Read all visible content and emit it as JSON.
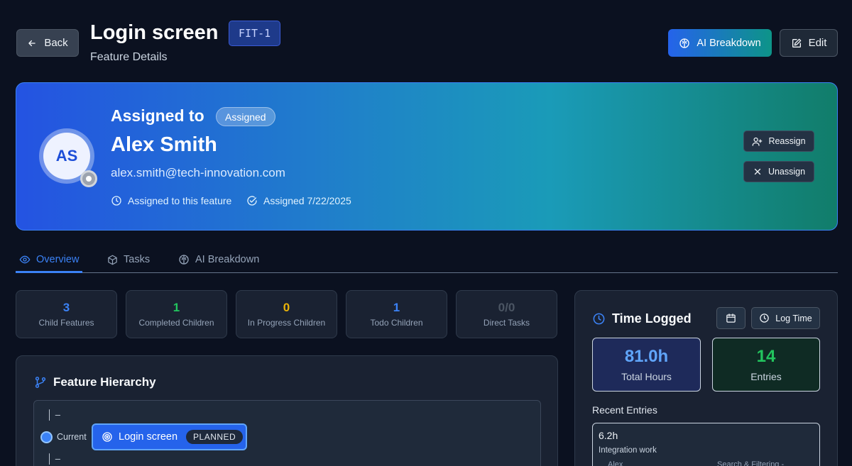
{
  "header": {
    "back_label": "Back",
    "title": "Login screen",
    "id_badge": "FIT-1",
    "subtitle": "Feature Details",
    "ai_breakdown_label": "AI Breakdown",
    "edit_label": "Edit"
  },
  "assignment": {
    "heading": "Assigned to",
    "status": "Assigned",
    "initials": "AS",
    "name": "Alex Smith",
    "email": "alex.smith@tech-innovation.com",
    "meta_scope": "Assigned to this feature",
    "meta_date": "Assigned 7/22/2025",
    "reassign_label": "Reassign",
    "unassign_label": "Unassign"
  },
  "tabs": [
    {
      "label": "Overview",
      "active": true
    },
    {
      "label": "Tasks",
      "active": false
    },
    {
      "label": "AI Breakdown",
      "active": false
    }
  ],
  "stats": [
    {
      "value": "3",
      "label": "Child Features",
      "color": "#3b82f6"
    },
    {
      "value": "1",
      "label": "Completed Children",
      "color": "#22c55e"
    },
    {
      "value": "0",
      "label": "In Progress Children",
      "color": "#eab308"
    },
    {
      "value": "1",
      "label": "Todo Children",
      "color": "#3b82f6"
    },
    {
      "value": "0/0",
      "label": "Direct Tasks",
      "color": "#4b5563"
    }
  ],
  "hierarchy": {
    "title": "Feature Hierarchy",
    "line_above": "│ –",
    "current_label": "Current",
    "feature_name": "Login screen",
    "feature_status": "PLANNED",
    "line_below": "│ –"
  },
  "time": {
    "title": "Time Logged",
    "log_time_label": "Log Time",
    "total_hours": "81.0h",
    "total_hours_label": "Total Hours",
    "entries": "14",
    "entries_label": "Entries",
    "recent_title": "Recent Entries",
    "recent": [
      {
        "hours": "6.2h",
        "description": "Integration work",
        "user": "Alex",
        "feature": "Search & Filtering -"
      }
    ]
  },
  "colors": {
    "accent": "#3b82f6",
    "success": "#22c55e",
    "warning": "#eab308"
  }
}
